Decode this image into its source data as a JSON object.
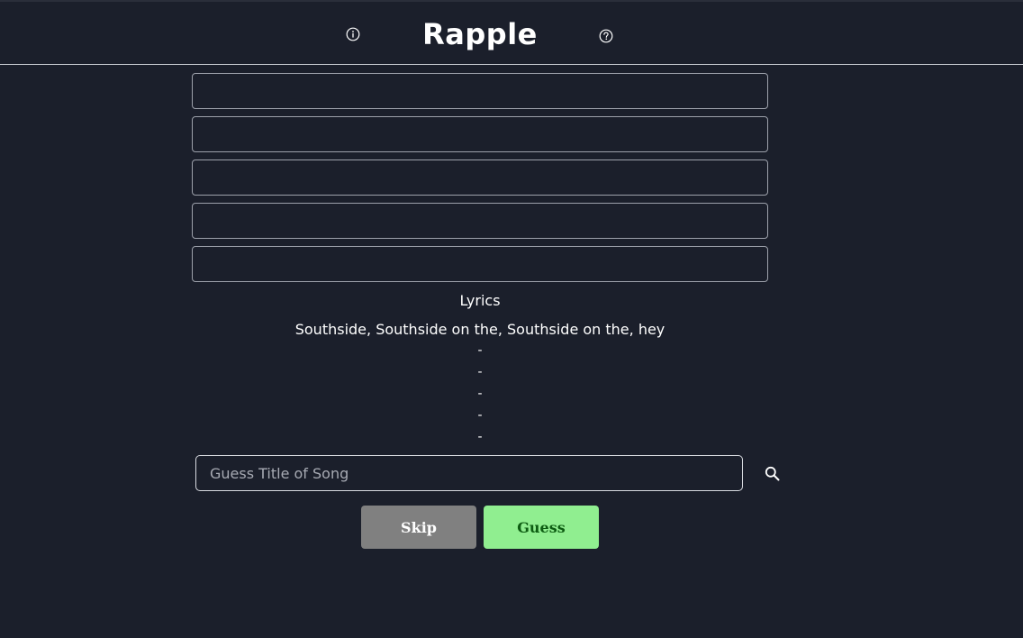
{
  "header": {
    "title": "Rapple",
    "info_icon": "info-icon",
    "help_icon": "help-icon"
  },
  "guess_slots": [
    "",
    "",
    "",
    "",
    ""
  ],
  "lyrics": {
    "heading": "Lyrics",
    "line": "Southside, Southside on the, Southside on the, hey",
    "hidden_lines": [
      "-",
      "-",
      "-",
      "-",
      "-"
    ]
  },
  "search": {
    "placeholder": "Guess Title of Song",
    "value": "",
    "icon": "search-icon"
  },
  "buttons": {
    "skip_label": "Skip",
    "guess_label": "Guess"
  },
  "colors": {
    "background": "#1b1f2b",
    "skip": "#808080",
    "guess": "#90ee90",
    "guess_text": "#0d5c12"
  }
}
